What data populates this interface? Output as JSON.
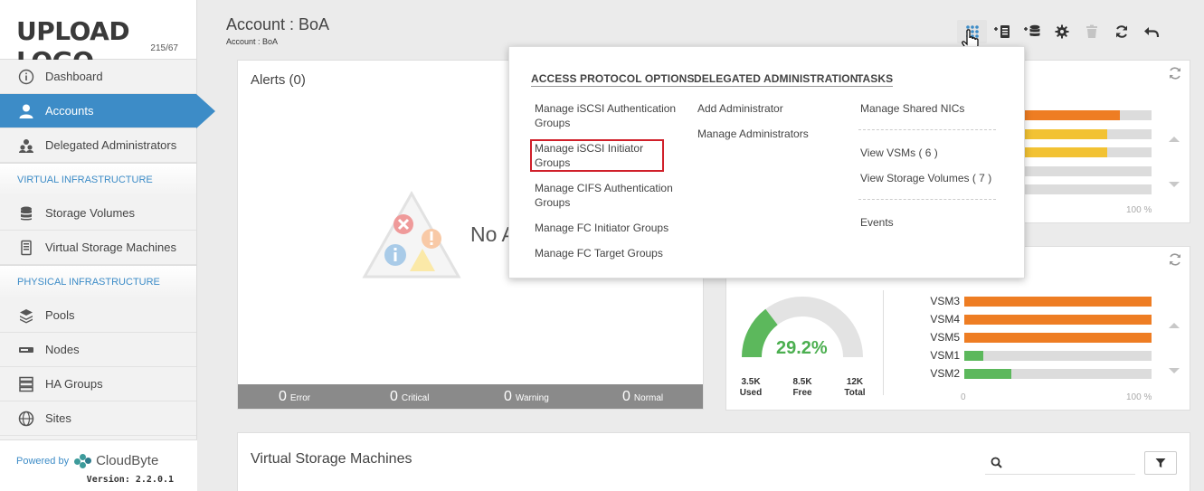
{
  "logo": {
    "text": "UPLOAD LOGO",
    "size": "215/67"
  },
  "sidebar": {
    "items": [
      {
        "label": "Dashboard",
        "icon": "info-icon"
      },
      {
        "label": "Accounts",
        "icon": "user-icon"
      },
      {
        "label": "Delegated Administrators",
        "icon": "users-icon"
      }
    ],
    "section_virtual": "VIRTUAL INFRASTRUCTURE",
    "virtual_items": [
      {
        "label": "Storage Volumes",
        "icon": "database-icon"
      },
      {
        "label": "Virtual Storage Machines",
        "icon": "server-icon"
      }
    ],
    "section_physical": "PHYSICAL INFRASTRUCTURE",
    "physical_items": [
      {
        "label": "Pools",
        "icon": "layers-icon"
      },
      {
        "label": "Nodes",
        "icon": "node-icon"
      },
      {
        "label": "HA Groups",
        "icon": "ha-group-icon"
      },
      {
        "label": "Sites",
        "icon": "globe-icon"
      }
    ],
    "powered_by": "Powered by",
    "brand": "CloudByte",
    "version": "Version: 2.2.0.1"
  },
  "header": {
    "title": "Account : BoA",
    "breadcrumb": "Account : BoA"
  },
  "alerts": {
    "title": "Alerts (0)",
    "empty_text": "No A",
    "counts": [
      {
        "value": "0",
        "label": "Error"
      },
      {
        "value": "0",
        "label": "Critical"
      },
      {
        "value": "0",
        "label": "Warning"
      },
      {
        "value": "0",
        "label": "Normal"
      }
    ]
  },
  "top_panel": {
    "axis_start": "",
    "axis_end": "100 %",
    "bars": [
      {
        "fill": 0.75,
        "color": "#ee7d23"
      },
      {
        "fill": 0.65,
        "color": "#f2c233"
      },
      {
        "fill": 0.65,
        "color": "#f2c233"
      },
      {
        "fill": 0,
        "color": "#dcdcdc"
      },
      {
        "fill": 0,
        "color": "#dcdcdc"
      }
    ]
  },
  "usage_panel": {
    "percent": "29.2%",
    "gauge_fraction": 0.292,
    "used_value": "3.5K",
    "used_label": "Used",
    "free_value": "8.5K",
    "free_label": "Free",
    "total_value": "12K",
    "total_label": "Total",
    "axis_start": "0",
    "axis_end": "100 %",
    "bars": [
      {
        "label": "VSM3",
        "fill": 1.0,
        "color": "#ee7d23"
      },
      {
        "label": "VSM4",
        "fill": 1.0,
        "color": "#ee7d23"
      },
      {
        "label": "VSM5",
        "fill": 1.0,
        "color": "#ee7d23"
      },
      {
        "label": "VSM1",
        "fill": 0.1,
        "color": "#5cb85c"
      },
      {
        "label": "VSM2",
        "fill": 0.25,
        "color": "#5cb85c"
      }
    ]
  },
  "vsm_panel": {
    "title": "Virtual Storage Machines"
  },
  "dropdown": {
    "access_head": "ACCESS PROTOCOL OPTIONS",
    "access_items": [
      "Manage iSCSI Authentication Groups",
      "Manage iSCSI Initiator Groups",
      "Manage CIFS Authentication Groups",
      "Manage FC Initiator Groups",
      "Manage FC Target Groups"
    ],
    "deleg_head": "DELEGATED ADMINISTRATION",
    "deleg_items": [
      "Add Administrator",
      "Manage Administrators"
    ],
    "tasks_head": "TASKS",
    "tasks_items": [
      "Manage Shared NICs",
      "View VSMs ( 6 )",
      "View Storage Volumes ( 7 )",
      "Events"
    ]
  },
  "colors": {
    "accent": "#3d8cc7",
    "orange": "#ee7d23",
    "yellow": "#f2c233",
    "green": "#5cb85c",
    "highlight": "#d0202a"
  }
}
